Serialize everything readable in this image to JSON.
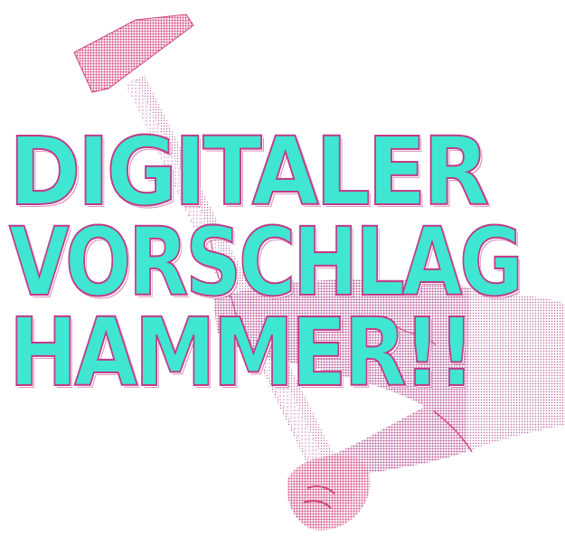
{
  "headline": {
    "line1": "DIGITALER",
    "line2": "VORSCHLAG",
    "line3": "HAMMER!!"
  },
  "colors": {
    "text_fill": "#3fe6d2",
    "text_outline": "#c23a86",
    "hammer_head": "#d2467f",
    "arm": "#b2438f",
    "background": "#ffffff"
  },
  "icons": {
    "hammer": "hammer-icon",
    "arm": "arm-illustration"
  }
}
